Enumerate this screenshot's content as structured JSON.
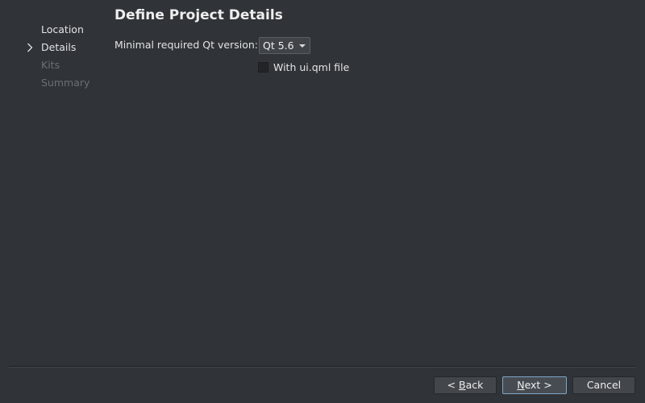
{
  "page": {
    "title": "Define Project Details"
  },
  "steps": [
    {
      "label": "Location",
      "state": "done"
    },
    {
      "label": "Details",
      "state": "current"
    },
    {
      "label": "Kits",
      "state": "disabled"
    },
    {
      "label": "Summary",
      "state": "disabled"
    }
  ],
  "form": {
    "qt_version_label": "Minimal required Qt version:",
    "qt_version_value": "Qt 5.6",
    "uiqml_checkbox_label": "With ui.qml file",
    "uiqml_checked": false
  },
  "buttons": {
    "back_prefix": "< ",
    "back_mnemonic": "B",
    "back_rest": "ack",
    "next_mnemonic": "N",
    "next_rest": "ext >",
    "cancel": "Cancel"
  },
  "icons": {
    "current_step": "chevron-right-icon",
    "combo_arrow": "triangle-down-icon"
  },
  "colors": {
    "background": "#303337",
    "disabled_text": "#6b7075",
    "default_button_border": "#7ea7c9"
  }
}
